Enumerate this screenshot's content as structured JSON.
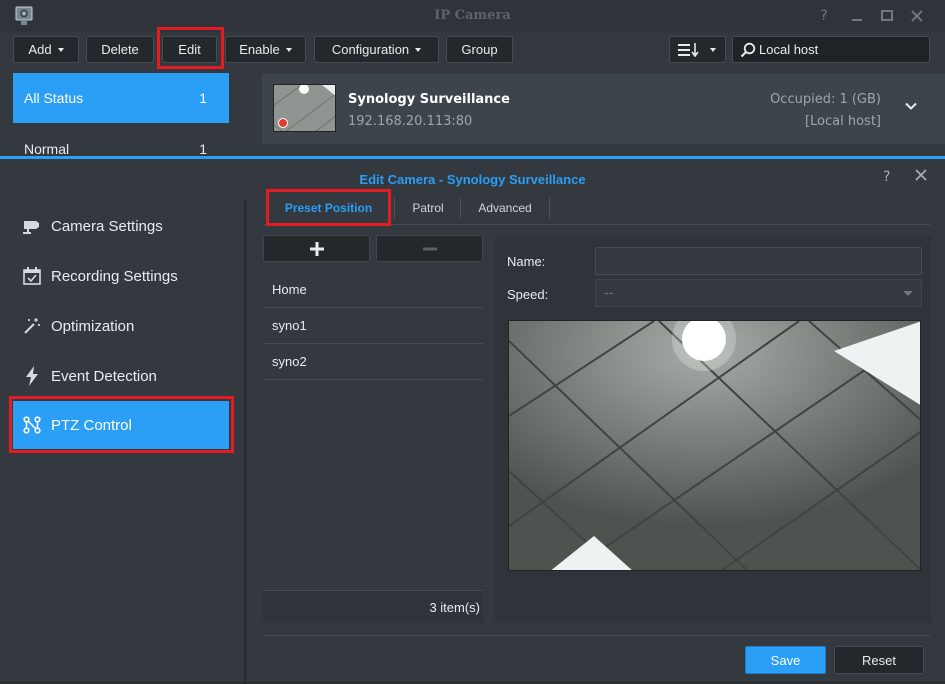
{
  "main_window": {
    "title": "IP Camera",
    "toolbar": {
      "add_label": "Add",
      "delete_label": "Delete",
      "edit_label": "Edit",
      "enable_label": "Enable",
      "configuration_label": "Configuration",
      "group_label": "Group"
    },
    "search": {
      "value": "Local host"
    },
    "status_filters": [
      {
        "label": "All Status",
        "count": "1"
      },
      {
        "label": "Normal",
        "count": "1"
      }
    ],
    "camera": {
      "name": "Synology Surveillance",
      "address": "192.168.20.113:80",
      "occupied": "Occupied: 1 (GB)",
      "host": "[Local host]"
    }
  },
  "edit_dialog": {
    "title": "Edit Camera - Synology Surveillance",
    "nav": [
      {
        "label": "Camera Settings",
        "icon": "camera-icon"
      },
      {
        "label": "Recording Settings",
        "icon": "calendar-icon"
      },
      {
        "label": "Optimization",
        "icon": "magic-wand-icon"
      },
      {
        "label": "Event Detection",
        "icon": "lightning-icon"
      },
      {
        "label": "PTZ Control",
        "icon": "ptz-icon"
      }
    ],
    "tabs": [
      "Preset Position",
      "Patrol",
      "Advanced"
    ],
    "presets": [
      "Home",
      "syno1",
      "syno2"
    ],
    "item_count": "3 item(s)",
    "name_label": "Name:",
    "speed_label": "Speed:",
    "speed_value": "--",
    "save_label": "Save",
    "reset_label": "Reset"
  },
  "colors": {
    "accent": "#2b9ef5",
    "highlight_frame": "#e31b23",
    "background": "#33393f"
  }
}
